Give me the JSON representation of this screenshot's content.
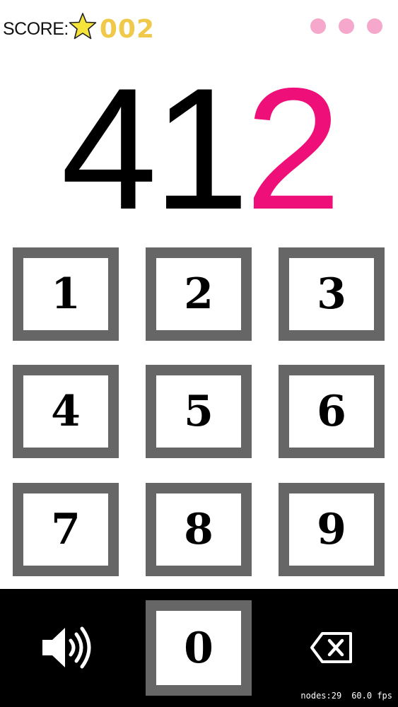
{
  "score": {
    "label": "SCORE:",
    "value": "002",
    "icon": "star-icon"
  },
  "menu": {
    "icon": "more-dots-icon"
  },
  "display": {
    "digits_black": "41",
    "digits_pink": "2"
  },
  "keypad": {
    "k1": "1",
    "k2": "2",
    "k3": "3",
    "k4": "4",
    "k5": "5",
    "k6": "6",
    "k7": "7",
    "k8": "8",
    "k9": "9",
    "k0": "0"
  },
  "controls": {
    "sound_icon": "speaker-icon",
    "delete_icon": "backspace-icon"
  },
  "stats": {
    "nodes": "nodes:29",
    "fps": "60.0 fps"
  },
  "colors": {
    "accent_pink": "#ee0f78",
    "score_gold": "#f0c94a",
    "key_border": "#666666",
    "dots_pink": "#f5a8cc"
  }
}
